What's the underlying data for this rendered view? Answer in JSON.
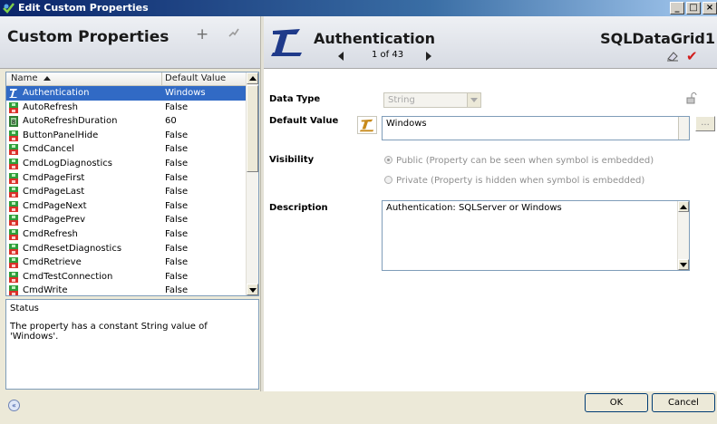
{
  "window": {
    "title": "Edit Custom Properties",
    "controls": [
      "_",
      "□",
      "×"
    ]
  },
  "left": {
    "title": "Custom Properties",
    "add_label": "+",
    "columns": {
      "name": "Name",
      "default": "Default Value"
    },
    "rows": [
      {
        "name": "Authentication",
        "default": "Windows",
        "icon": "string-t-icon",
        "selected": true
      },
      {
        "name": "AutoRefresh",
        "default": "False",
        "icon": "boolean-icon"
      },
      {
        "name": "AutoRefreshDuration",
        "default": "60",
        "icon": "integer-icon"
      },
      {
        "name": "ButtonPanelHide",
        "default": "False",
        "icon": "boolean-icon"
      },
      {
        "name": "CmdCancel",
        "default": "False",
        "icon": "boolean-icon"
      },
      {
        "name": "CmdLogDiagnostics",
        "default": "False",
        "icon": "boolean-icon"
      },
      {
        "name": "CmdPageFirst",
        "default": "False",
        "icon": "boolean-icon"
      },
      {
        "name": "CmdPageLast",
        "default": "False",
        "icon": "boolean-icon"
      },
      {
        "name": "CmdPageNext",
        "default": "False",
        "icon": "boolean-icon"
      },
      {
        "name": "CmdPagePrev",
        "default": "False",
        "icon": "boolean-icon"
      },
      {
        "name": "CmdRefresh",
        "default": "False",
        "icon": "boolean-icon"
      },
      {
        "name": "CmdResetDiagnostics",
        "default": "False",
        "icon": "boolean-icon"
      },
      {
        "name": "CmdRetrieve",
        "default": "False",
        "icon": "boolean-icon"
      },
      {
        "name": "CmdTestConnection",
        "default": "False",
        "icon": "boolean-icon"
      },
      {
        "name": "CmdWrite",
        "default": "False",
        "icon": "boolean-icon"
      }
    ],
    "status": {
      "title": "Status",
      "text": "The property has a constant String value of 'Windows'."
    }
  },
  "right": {
    "property": "Authentication",
    "symbol": "SQLDataGrid1",
    "nav_text": "1 of 43",
    "data_type": {
      "label": "Data Type",
      "value": "String"
    },
    "default_value": {
      "label": "Default Value",
      "value": "Windows"
    },
    "visibility": {
      "label": "Visibility",
      "public": "Public (Property can be seen when symbol is embedded)",
      "private": "Private (Property is hidden when symbol is embedded)"
    },
    "description": {
      "label": "Description",
      "value": "Authentication: SQLServer or Windows"
    }
  },
  "buttons": {
    "ok": "OK",
    "cancel": "Cancel"
  },
  "colors": {
    "selection": "#316ac5",
    "accent_red": "#d21d1d"
  }
}
